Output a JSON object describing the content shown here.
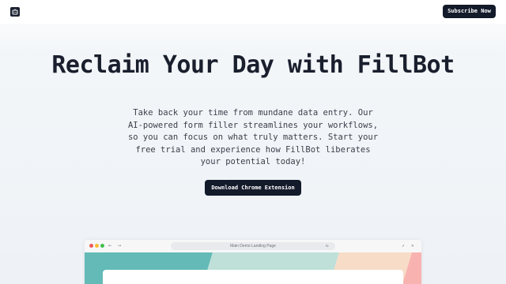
{
  "header": {
    "logo_icon": "robot-icon",
    "subscribe_label": "Subscribe Now"
  },
  "hero": {
    "title": "Reclaim Your Day with FillBot",
    "description": "Take back your time from mundane data entry. Our AI-powered form filler streamlines your workflows, so you can focus on what truly matters. Start your free trial and experience how FillBot liberates your potential today!",
    "cta_label": "Download Chrome Extension"
  },
  "browser": {
    "url_text": "Main Demo Landing Page",
    "back_icon": "←",
    "forward_icon": "→",
    "reload_icon": "↻",
    "open_icon": "↗",
    "close_icon": "✕",
    "band_colors": [
      "#63bab6",
      "#bee0d9",
      "#f7dcc7",
      "#f8b3b0"
    ]
  },
  "colors": {
    "primary_dark": "#131a2a",
    "text": "#1a1f2e"
  }
}
